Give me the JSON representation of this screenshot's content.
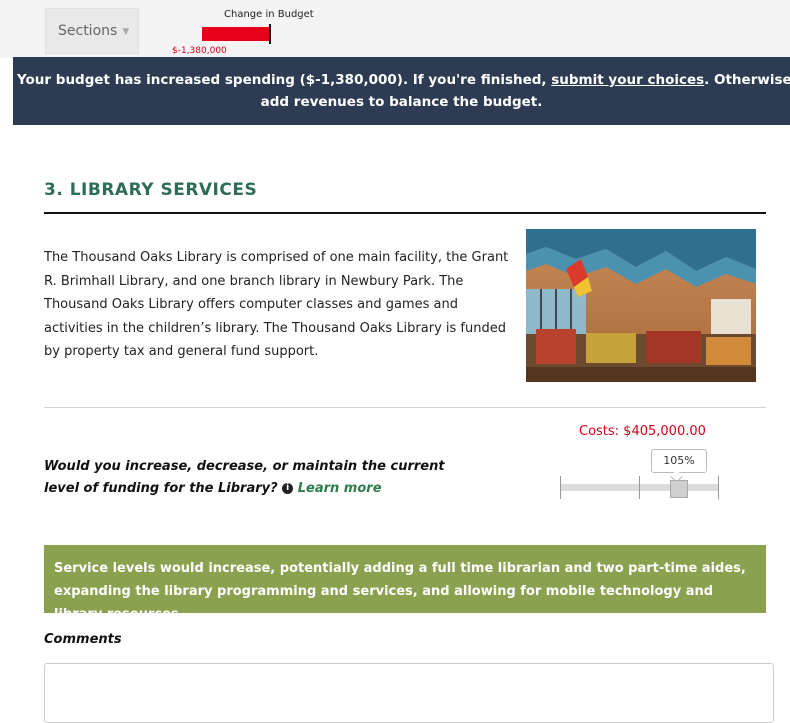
{
  "header": {
    "sections_label": "Sections",
    "budget_chart_title": "Change in Budget",
    "budget_value": "$-1,380,000"
  },
  "banner": {
    "text_before": "Your budget has increased spending ($-1,380,000). If you're finished,",
    "link": "submit your choices",
    "text_after_line1": ". Otherwise, cut activities or",
    "text_line2": "add revenues to balance the budget."
  },
  "section": {
    "title": "3. LIBRARY SERVICES",
    "description": "The Thousand Oaks Library is comprised of one main facility, the Grant R. Brimhall Library, and one branch library in Newbury Park. The Thousand Oaks Library offers computer classes and games and activities in the children’s library. The Thousand Oaks Library is funded by property tax and general fund support.",
    "photo_alt": "Library interior"
  },
  "funding": {
    "costs": "Costs: $405,000.00",
    "question": "Would you increase, decrease, or maintain the current level of funding for the Library?",
    "learn_more": "Learn more",
    "slider_value": "105%",
    "slider_percent": 105
  },
  "outcome": {
    "text": "Service levels would increase, potentially adding a full time librarian and two part-time aides, expanding the library programming and services, and allowing for mobile technology and library resources."
  },
  "comments": {
    "label": "Comments",
    "value": ""
  },
  "colors": {
    "banner": "#2d3c52",
    "title_green": "#2e6d55",
    "outcome_green": "#8aa250",
    "cost_red": "#d6001c"
  }
}
